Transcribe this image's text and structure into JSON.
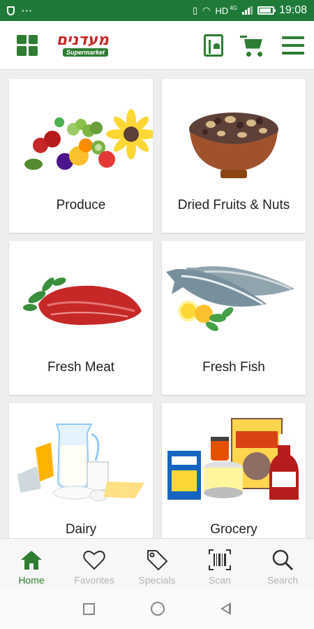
{
  "status": {
    "time": "19:08",
    "network": "HD",
    "network_gen": "4G",
    "dots": "···"
  },
  "app": {
    "logo_hebrew": "מעדנים",
    "logo_sub": "Supermarket",
    "accent": "#2e7d32",
    "statusbar_color": "#1f7a3a"
  },
  "header_icons": [
    "grid-icon",
    "recipe-book-icon",
    "cart-icon",
    "menu-icon"
  ],
  "categories": [
    {
      "label": "Produce",
      "image": "produce-image"
    },
    {
      "label": "Dried Fruits & Nuts",
      "image": "dried-fruits-nuts-image"
    },
    {
      "label": "Fresh Meat",
      "image": "fresh-meat-image"
    },
    {
      "label": "Fresh Fish",
      "image": "fresh-fish-image"
    },
    {
      "label": "Dairy",
      "image": "dairy-image"
    },
    {
      "label": "Grocery",
      "image": "grocery-image"
    }
  ],
  "nav": {
    "items": [
      {
        "label": "Home",
        "icon": "home-icon",
        "active": true
      },
      {
        "label": "Favorites",
        "icon": "heart-icon",
        "active": false
      },
      {
        "label": "Specials",
        "icon": "tag-icon",
        "active": false
      },
      {
        "label": "Scan",
        "icon": "barcode-icon",
        "active": false
      },
      {
        "label": "Search",
        "icon": "search-icon",
        "active": false
      }
    ]
  }
}
